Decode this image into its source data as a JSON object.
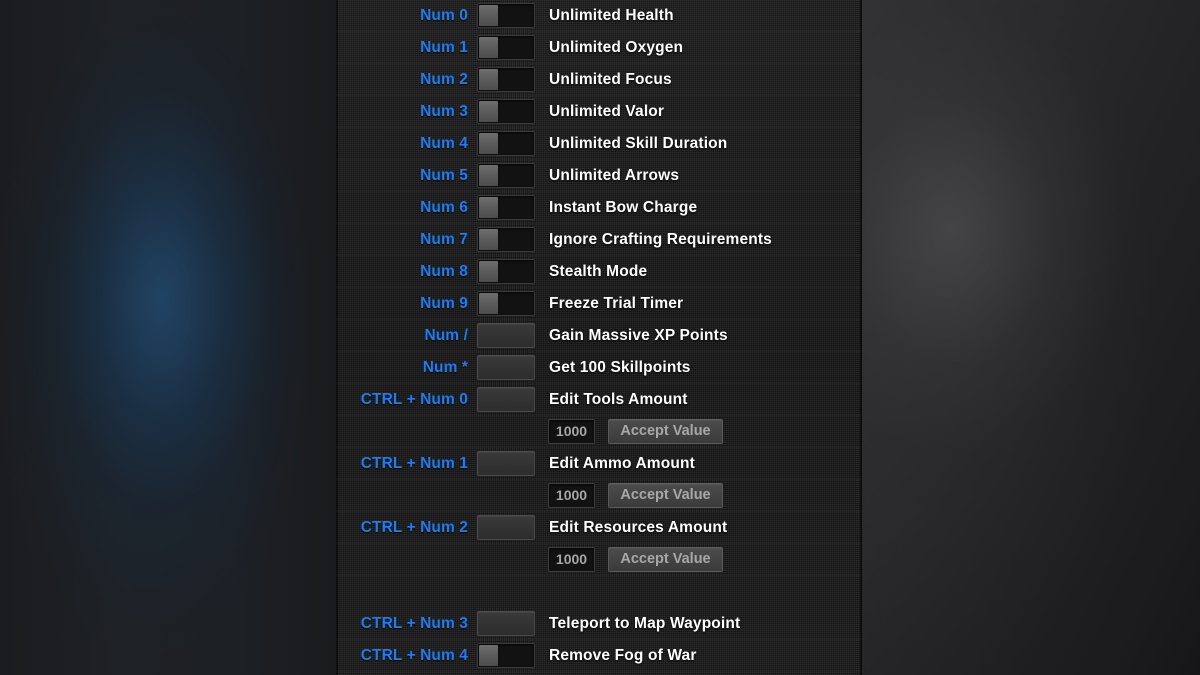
{
  "panel": {
    "accent_blue": "#1a7ef5",
    "label_color": "#ffffff",
    "background": "#1c1c1c"
  },
  "rows": [
    {
      "type": "toggle",
      "hotkey": "Num 0",
      "label": "Unlimited Health",
      "state": "off"
    },
    {
      "type": "toggle",
      "hotkey": "Num 1",
      "label": "Unlimited Oxygen",
      "state": "off"
    },
    {
      "type": "toggle",
      "hotkey": "Num 2",
      "label": "Unlimited Focus",
      "state": "off"
    },
    {
      "type": "toggle",
      "hotkey": "Num 3",
      "label": "Unlimited Valor",
      "state": "off"
    },
    {
      "type": "toggle",
      "hotkey": "Num 4",
      "label": "Unlimited Skill Duration",
      "state": "off"
    },
    {
      "type": "toggle",
      "hotkey": "Num 5",
      "label": "Unlimited Arrows",
      "state": "off"
    },
    {
      "type": "toggle",
      "hotkey": "Num 6",
      "label": "Instant Bow Charge",
      "state": "off"
    },
    {
      "type": "toggle",
      "hotkey": "Num 7",
      "label": "Ignore Crafting Requirements",
      "state": "off"
    },
    {
      "type": "toggle",
      "hotkey": "Num 8",
      "label": "Stealth Mode",
      "state": "off"
    },
    {
      "type": "toggle",
      "hotkey": "Num 9",
      "label": "Freeze Trial Timer",
      "state": "off"
    },
    {
      "type": "action",
      "hotkey": "Num /",
      "label": "Gain Massive XP Points"
    },
    {
      "type": "action",
      "hotkey": "Num *",
      "label": "Get 100 Skillpoints"
    },
    {
      "type": "action",
      "hotkey": "CTRL + Num 0",
      "label": "Edit Tools Amount"
    },
    {
      "type": "value",
      "value": "1000",
      "button": "Accept Value"
    },
    {
      "type": "action",
      "hotkey": "CTRL + Num 1",
      "label": "Edit Ammo Amount"
    },
    {
      "type": "value",
      "value": "1000",
      "button": "Accept Value"
    },
    {
      "type": "action",
      "hotkey": "CTRL + Num 2",
      "label": "Edit Resources Amount"
    },
    {
      "type": "value",
      "value": "1000",
      "button": "Accept Value"
    },
    {
      "type": "spacer"
    },
    {
      "type": "action",
      "hotkey": "CTRL + Num 3",
      "label": "Teleport to Map Waypoint"
    },
    {
      "type": "toggle",
      "hotkey": "CTRL + Num 4",
      "label": "Remove Fog of War",
      "state": "off"
    }
  ]
}
